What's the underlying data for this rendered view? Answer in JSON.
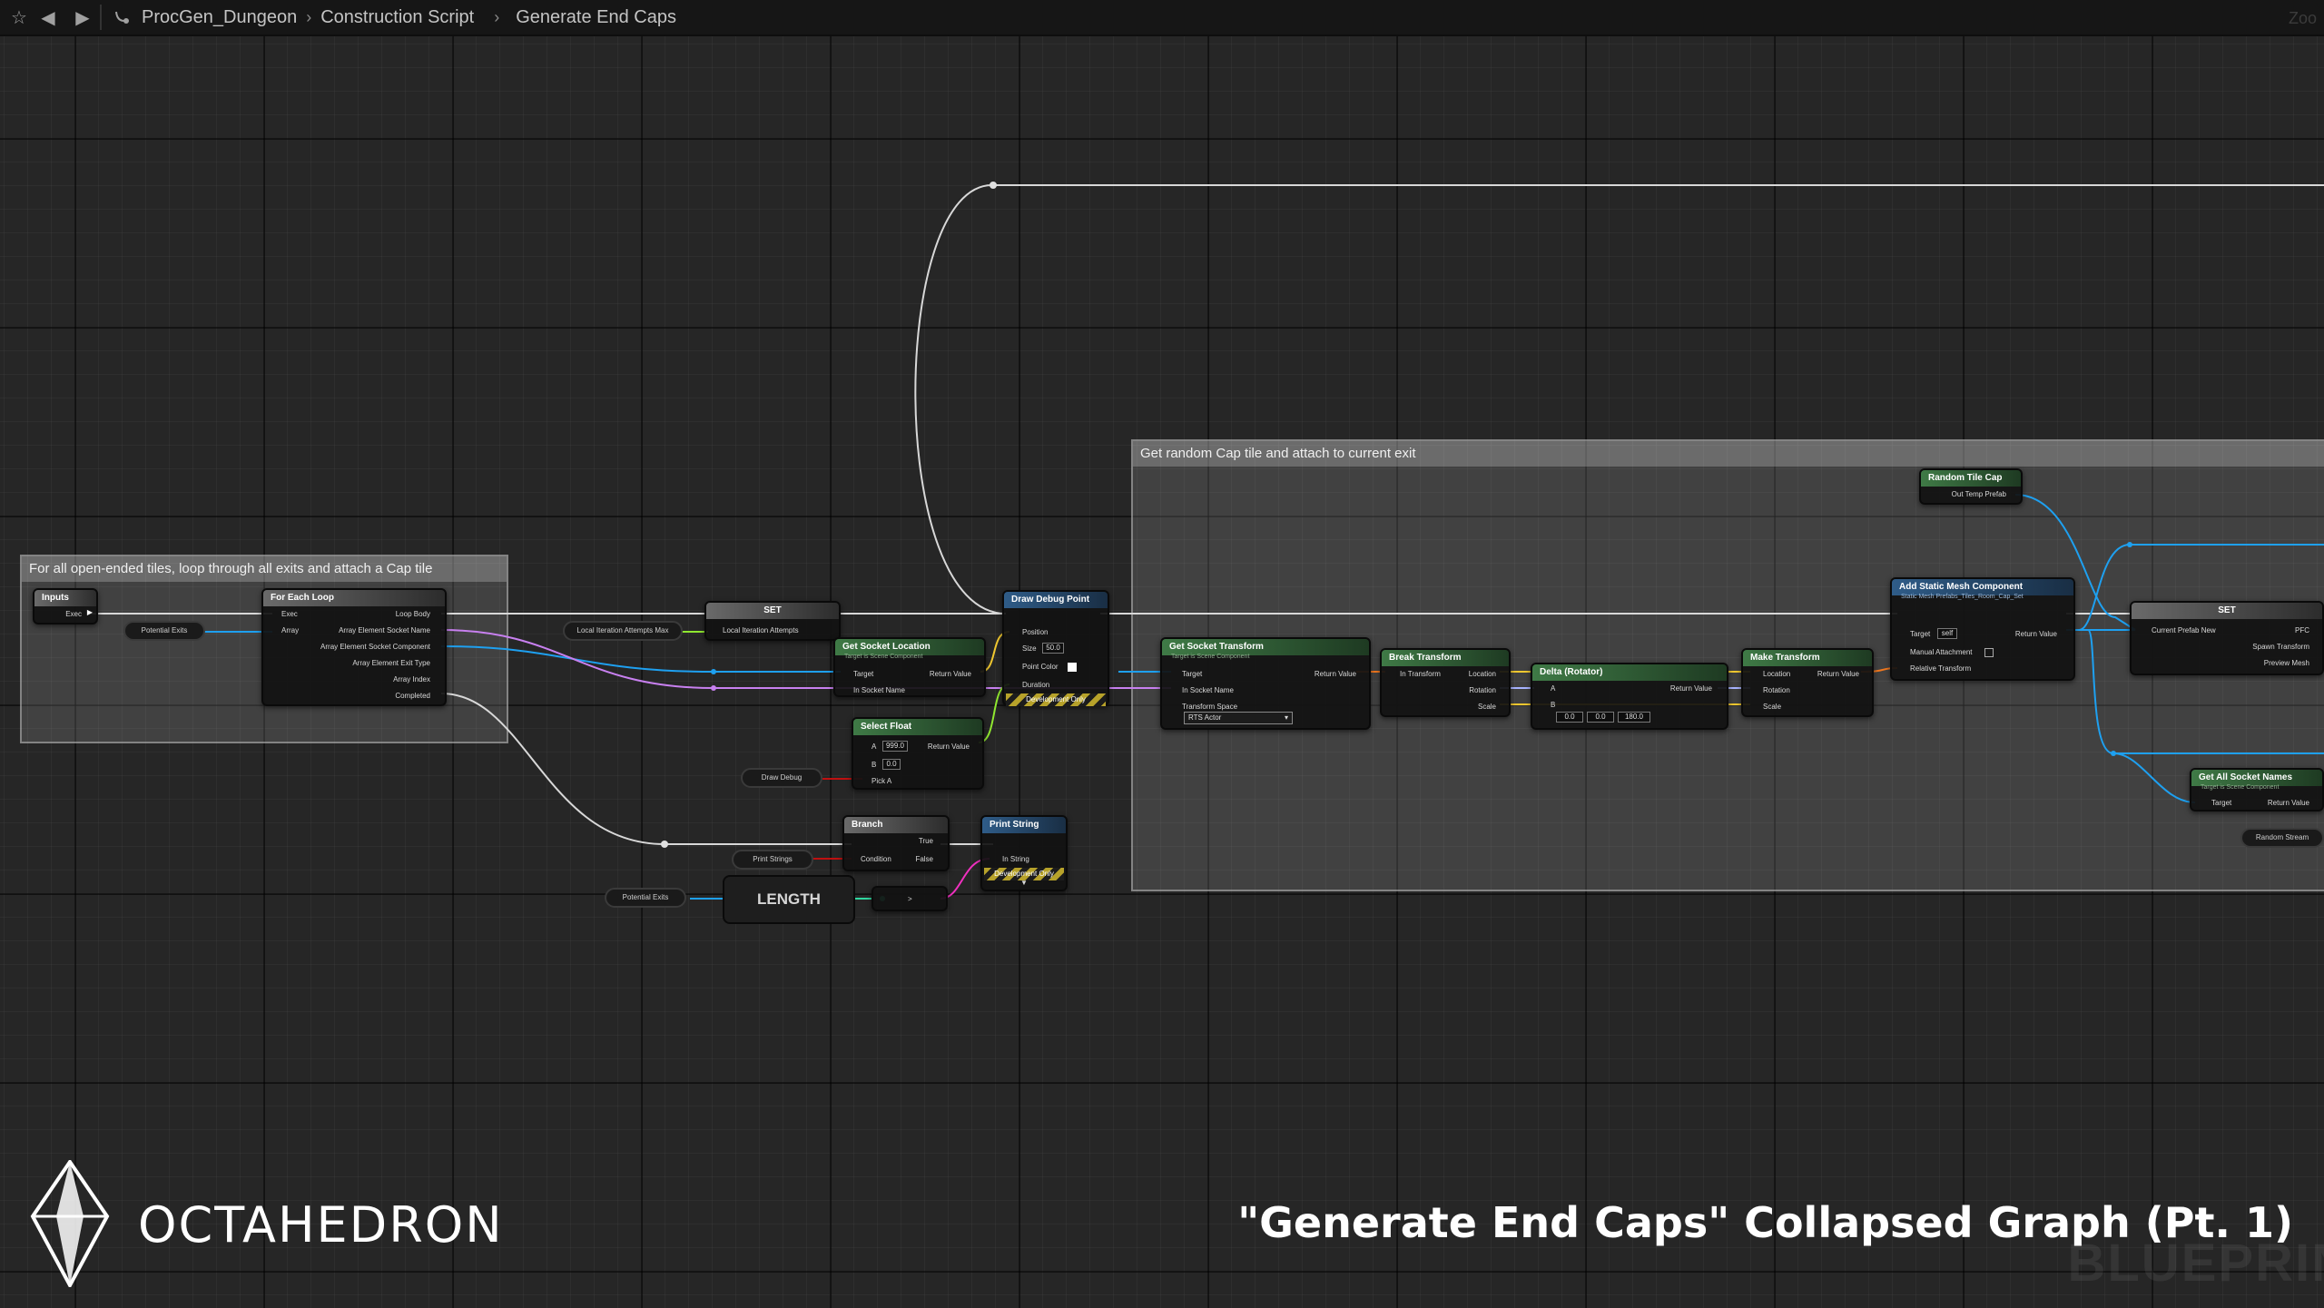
{
  "toolbar": {
    "breadcrumbs": [
      "ProcGen_Dungeon",
      "Construction Script",
      "Generate End Caps"
    ],
    "zoom_label": "Zoo",
    "icons": [
      "star-icon",
      "back-arrow-icon",
      "forward-arrow-icon",
      "function-graph-icon"
    ]
  },
  "comments": {
    "loop": "For all open-ended tiles, loop through all exits and attach a Cap tile",
    "cap": "Get random Cap tile and attach to current exit"
  },
  "nodes": {
    "inputs": {
      "title": "Inputs",
      "exec": "Exec"
    },
    "potential_exits": "Potential Exits",
    "for_each": {
      "title": "For Each Loop",
      "exec": "Exec",
      "array": "Array",
      "loop_body": "Loop Body",
      "out1": "Array Element Socket Name",
      "out2": "Array Element Socket Component",
      "out3": "Array Element Exit Type",
      "out4": "Array Index",
      "completed": "Completed"
    },
    "local_max": "Local Iteration Attempts Max",
    "set1": {
      "title": "SET",
      "pin": "Local Iteration Attempts"
    },
    "get_socket_location": {
      "title": "Get Socket Location",
      "sub": "Target is Scene Component",
      "target": "Target",
      "socket": "In Socket Name",
      "ret": "Return Value"
    },
    "draw_debug": {
      "title": "Draw Debug Point",
      "position": "Position",
      "size": "Size",
      "size_val": "50.0",
      "color": "Point Color",
      "duration": "Duration",
      "dev": "Development Only"
    },
    "select_float": {
      "title": "Select Float",
      "a": "A",
      "a_val": "999.0",
      "b": "B",
      "b_val": "0.0",
      "pick": "Pick A",
      "ret": "Return Value"
    },
    "draw_debug_var": "Draw Debug",
    "branch": {
      "title": "Branch",
      "cond": "Condition",
      "true": "True",
      "false": "False"
    },
    "print_strings": "Print Strings",
    "print_string": {
      "title": "Print String",
      "in": "In String",
      "dev": "Development Only"
    },
    "potential_exits2": "Potential Exits",
    "length": "LENGTH",
    "greater": ">",
    "get_socket_transform": {
      "title": "Get Socket Transform",
      "sub": "Target is Scene Component",
      "target": "Target",
      "socket": "In Socket Name",
      "space": "Transform Space",
      "space_val": "RTS Actor",
      "ret": "Return Value"
    },
    "break_transform": {
      "title": "Break Transform",
      "in": "In Transform",
      "loc": "Location",
      "rot": "Rotation",
      "scale": "Scale"
    },
    "delta": {
      "title": "Delta (Rotator)",
      "a": "A",
      "b": "B",
      "ret": "Return Value",
      "x": "0.0",
      "y": "0.0",
      "z": "180.0"
    },
    "make_transform": {
      "title": "Make Transform",
      "loc": "Location",
      "rot": "Rotation",
      "scale": "Scale",
      "ret": "Return Value"
    },
    "random_tile_cap": {
      "title": "Random Tile Cap",
      "out": "Out Temp Prefab"
    },
    "add_static_mesh": {
      "title": "Add Static Mesh Component",
      "sub": "Static Mesh Prefabs_Tiles_Room_Cap_Set",
      "target": "Target",
      "target_val": "self",
      "manual": "Manual Attachment",
      "rel": "Relative Transform",
      "ret": "Return Value"
    },
    "set2": {
      "title": "SET",
      "current": "Current Prefab New",
      "pfc": "PFC",
      "spawn": "Spawn Transform",
      "preview": "Preview Mesh"
    },
    "get_all_socket_names": {
      "title": "Get All Socket Names",
      "sub": "Target is Scene Component",
      "target": "Target",
      "ret": "Return Value"
    },
    "random_stream": "Random Stream"
  },
  "footer": {
    "logo": "OCTAHEDRON",
    "caption": "\"Generate End Caps\" Collapsed Graph (Pt. 1)",
    "watermark": "BLUEPRIN"
  },
  "colors": {
    "exec": "#ffffff",
    "object": "#1ea0f0",
    "name": "#c880f0",
    "vector": "#f0c830",
    "float": "#90e830",
    "bool": "#c01010",
    "string": "#f030c0",
    "transform": "#f07820",
    "rotator": "#a8b4ff",
    "int": "#30d8a0"
  }
}
